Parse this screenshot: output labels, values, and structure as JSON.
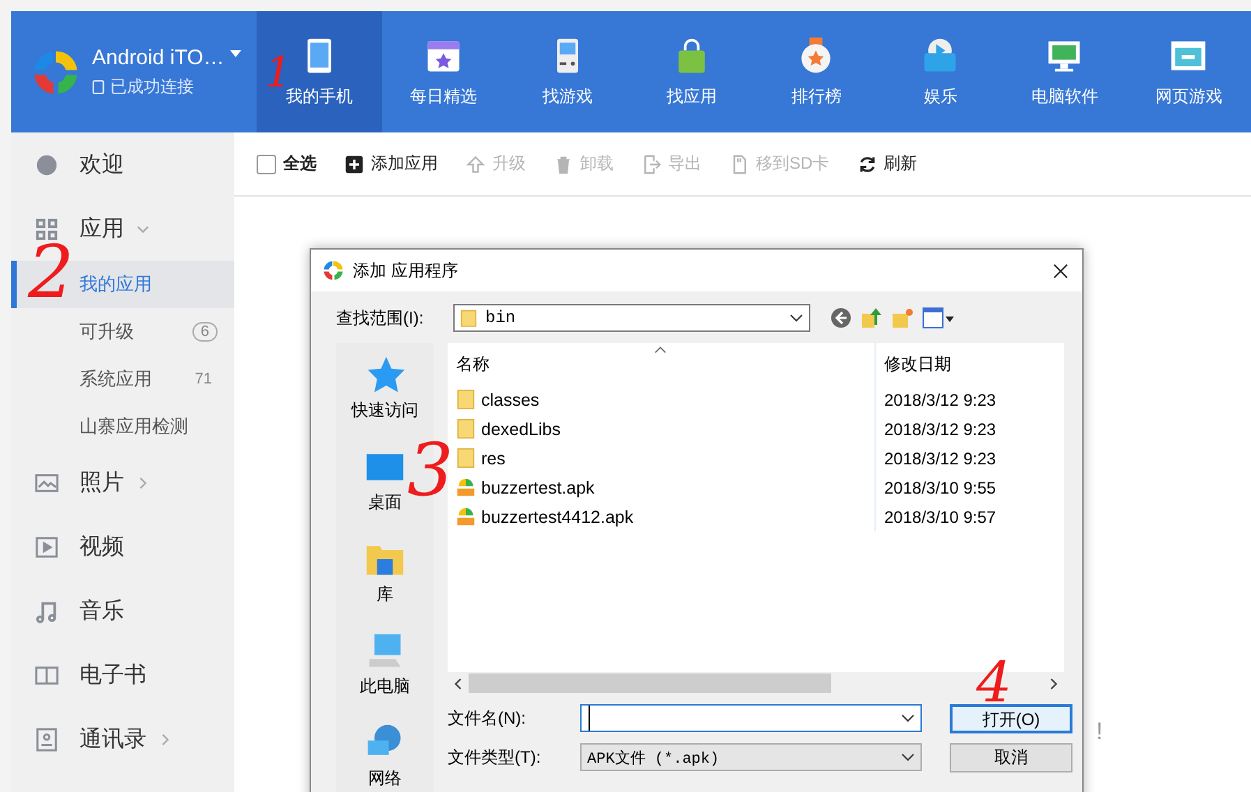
{
  "app": {
    "title": "Android iTO…",
    "status": "已成功连接"
  },
  "nav_tabs": [
    {
      "label": "我的手机",
      "kind": "phone",
      "selected": true
    },
    {
      "label": "每日精选",
      "kind": "calendar",
      "selected": false
    },
    {
      "label": "找游戏",
      "kind": "gameboy",
      "selected": false
    },
    {
      "label": "找应用",
      "kind": "bag",
      "selected": false
    },
    {
      "label": "排行榜",
      "kind": "medal",
      "selected": false
    },
    {
      "label": "娱乐",
      "kind": "play",
      "selected": false
    },
    {
      "label": "电脑软件",
      "kind": "monitor",
      "selected": false
    },
    {
      "label": "网页游戏",
      "kind": "browser",
      "selected": false
    }
  ],
  "sidebar": {
    "items": [
      {
        "label": "欢迎",
        "kind": "link"
      },
      {
        "label": "应用",
        "kind": "group",
        "expanded": true,
        "children": [
          {
            "label": "我的应用",
            "selected": true
          },
          {
            "label": "可升级",
            "selected": false,
            "badge": "6"
          },
          {
            "label": "系统应用",
            "selected": false,
            "badge": "71"
          },
          {
            "label": "山寨应用检测",
            "selected": false
          }
        ]
      },
      {
        "label": "照片",
        "kind": "group",
        "expanded": false
      },
      {
        "label": "视频",
        "kind": "link"
      },
      {
        "label": "音乐",
        "kind": "link"
      },
      {
        "label": "电子书",
        "kind": "link"
      },
      {
        "label": "通讯录",
        "kind": "group",
        "expanded": false
      }
    ]
  },
  "toolbar": [
    {
      "label": "全选",
      "kind": "checkbox",
      "checked": false
    },
    {
      "label": "添加应用",
      "kind": "plus",
      "disabled": false
    },
    {
      "label": "升级",
      "kind": "up",
      "disabled": true
    },
    {
      "label": "卸载",
      "kind": "trash",
      "disabled": true
    },
    {
      "label": "导出",
      "kind": "export",
      "disabled": true
    },
    {
      "label": "移到SD卡",
      "kind": "sd",
      "disabled": true
    },
    {
      "label": "刷新",
      "kind": "refresh",
      "disabled": false
    }
  ],
  "background_text": "!",
  "dialog": {
    "title": "添加 应用程序",
    "look_in_label": "查找范围(I):",
    "look_in_value": "bin",
    "places": [
      "快速访问",
      "桌面",
      "库",
      "此电脑",
      "网络"
    ],
    "columns": [
      "名称",
      "修改日期"
    ],
    "files": [
      {
        "name": "classes",
        "date": "2018/3/12 9:23",
        "kind": "folder"
      },
      {
        "name": "dexedLibs",
        "date": "2018/3/12 9:23",
        "kind": "folder"
      },
      {
        "name": "res",
        "date": "2018/3/12 9:23",
        "kind": "folder"
      },
      {
        "name": "buzzertest.apk",
        "date": "2018/3/10 9:55",
        "kind": "apk"
      },
      {
        "name": "buzzertest4412.apk",
        "date": "2018/3/10 9:57",
        "kind": "apk"
      }
    ],
    "filename_label": "文件名(N):",
    "filetype_label": "文件类型(T):",
    "filetype_value": "APK文件 (*.apk)",
    "buttons": [
      {
        "label": "打开(O)",
        "focused": true
      },
      {
        "label": "取消",
        "focused": false
      }
    ]
  },
  "annotations": [
    "1",
    "2",
    "3",
    "4"
  ]
}
